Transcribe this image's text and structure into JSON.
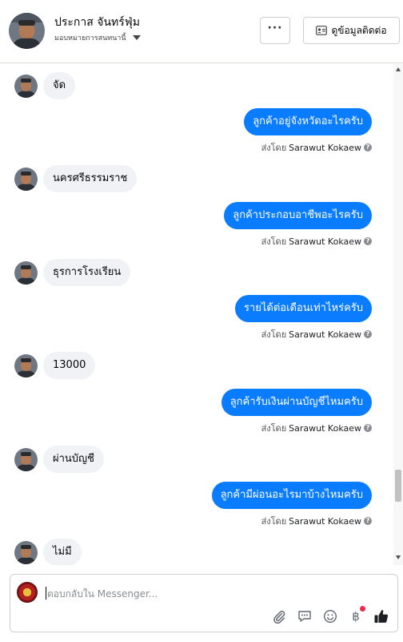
{
  "header": {
    "name": "ประกาส จันทร์ฟุ่ม",
    "subtitle": "มอบหมายการสนทนานี้",
    "more_label": "···",
    "contact_label": "ดูข้อมูลติดต่อ"
  },
  "messages": [
    {
      "dir": "in",
      "text": "จัด"
    },
    {
      "dir": "out",
      "text": "ลูกค้าอยู่จังหวัดอะไรครับ",
      "sent_prefix": "ส่งโดย",
      "sender": "Sarawut Kokaew"
    },
    {
      "dir": "in",
      "text": "นครศรีธรรมราช"
    },
    {
      "dir": "out",
      "text": "ลูกค้าประกอบอาชีพอะไรครับ",
      "sent_prefix": "ส่งโดย",
      "sender": "Sarawut Kokaew"
    },
    {
      "dir": "in",
      "text": "ธุรการโรงเรียน"
    },
    {
      "dir": "out",
      "text": "รายได้ต่อเดือนเท่าไหร่ครับ",
      "sent_prefix": "ส่งโดย",
      "sender": "Sarawut Kokaew"
    },
    {
      "dir": "in",
      "text": "13000"
    },
    {
      "dir": "out",
      "text": "ลูกค้ารับเงินผ่านบัญชีไหมครับ",
      "sent_prefix": "ส่งโดย",
      "sender": "Sarawut Kokaew"
    },
    {
      "dir": "in",
      "text": "ผ่านบัญชี"
    },
    {
      "dir": "out",
      "text": "ลูกค้ามีผ่อนอะไรมาบ้างไหมครับ",
      "sent_prefix": "ส่งโดย",
      "sender": "Sarawut Kokaew"
    },
    {
      "dir": "in",
      "text": "ไม่มี"
    }
  ],
  "composer": {
    "placeholder": "ตอบกลับใน Messenger..."
  },
  "icons": {
    "help": "?",
    "baht": "฿"
  },
  "colors": {
    "accent": "#0a7cff",
    "incoming_bubble": "#f0f2f5",
    "notification_dot": "#f02849"
  }
}
